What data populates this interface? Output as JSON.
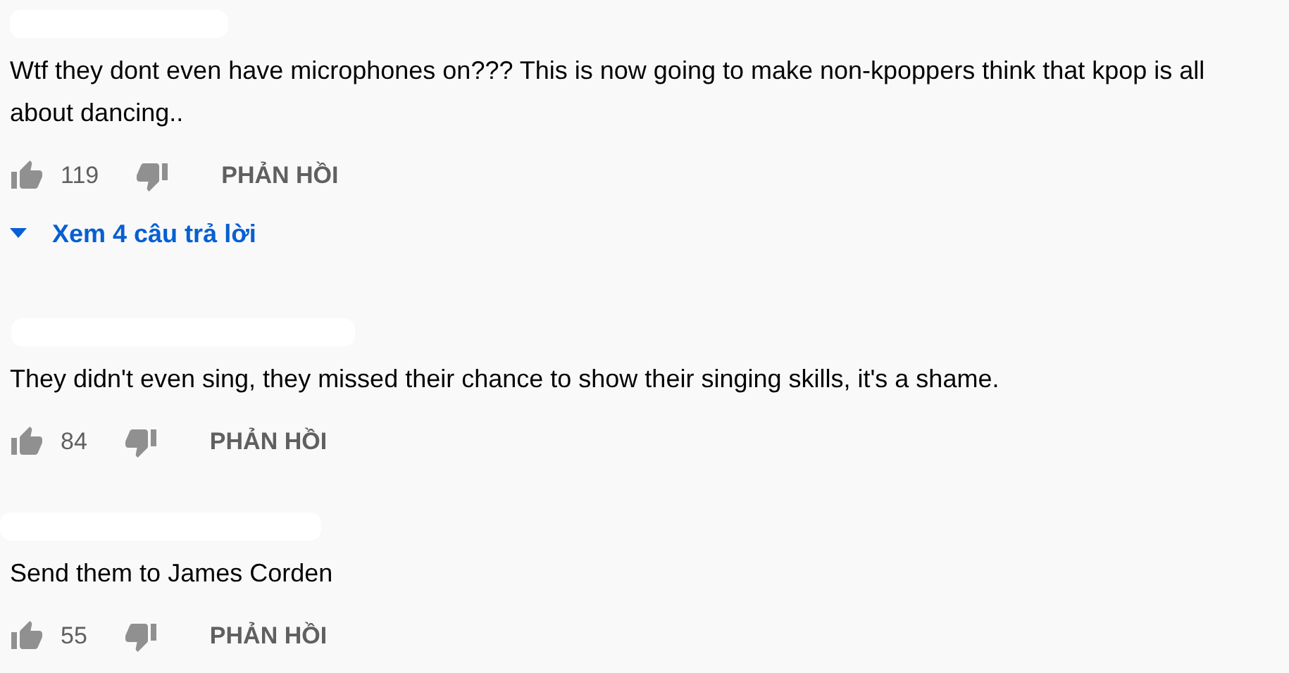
{
  "comments": [
    {
      "text": "Wtf they dont even have microphones on??? This is now going to make non-kpoppers think that kpop is all about dancing..",
      "likes": "119",
      "reply": "PHẢN HỒI",
      "replies_link": "Xem 4 câu trả lời"
    },
    {
      "text": "They didn't even sing, they missed their chance to show their singing skills, it's a shame.",
      "likes": "84",
      "reply": "PHẢN HỒI"
    },
    {
      "text": "Send them to James Corden",
      "likes": "55",
      "reply": "PHẢN HỒI"
    }
  ]
}
